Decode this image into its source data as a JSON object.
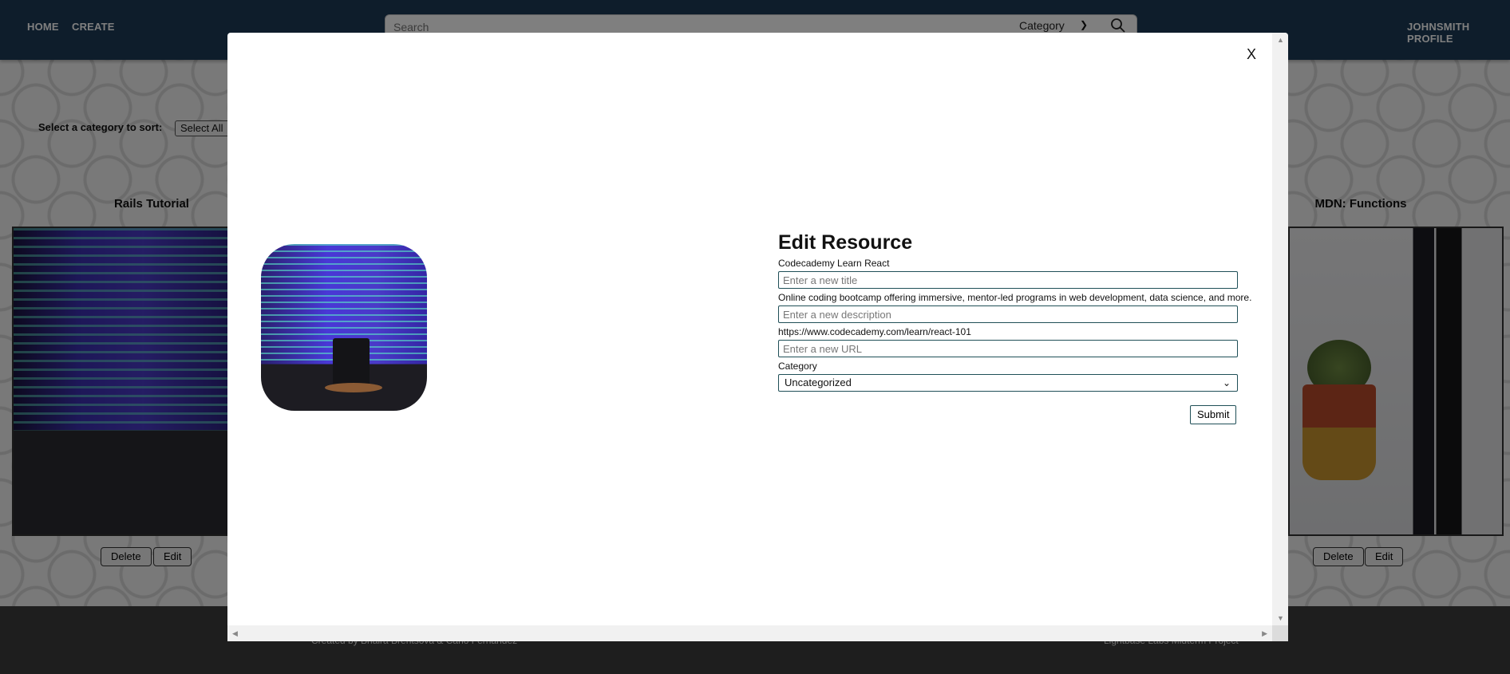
{
  "nav": {
    "home": "HOME",
    "create": "CREATE",
    "search_placeholder": "Search",
    "category_label": "Category",
    "profile": "JOHNSMITH PROFILE"
  },
  "page": {
    "sort_label": "Select a category to sort:",
    "sort_value": "Select All",
    "cards": [
      {
        "title": "Rails Tutorial",
        "delete_label": "Delete",
        "edit_label": "Edit"
      },
      {
        "title": "MDN: Functions",
        "delete_label": "Delete",
        "edit_label": "Edit"
      }
    ],
    "footer_left": "Created by Bhaira Brentsova & Carlo Fernandez",
    "footer_right": "Lightbase Labs Midterm Project"
  },
  "modal": {
    "close_label": "X",
    "heading": "Edit Resource",
    "current_title": "Codecademy Learn React",
    "title_placeholder": "Enter a new title",
    "current_description": "Online coding bootcamp offering immersive, mentor-led programs in web development, data science, and more.",
    "description_placeholder": "Enter a new description",
    "current_url": "https://www.codecademy.com/learn/react-101",
    "url_placeholder": "Enter a new URL",
    "category_label": "Category",
    "category_value": "Uncategorized",
    "submit_label": "Submit"
  },
  "colors": {
    "navbar": "#1d3b57",
    "input_border": "#1f4f57",
    "overlay": "rgba(0,0,0,0.5)"
  }
}
